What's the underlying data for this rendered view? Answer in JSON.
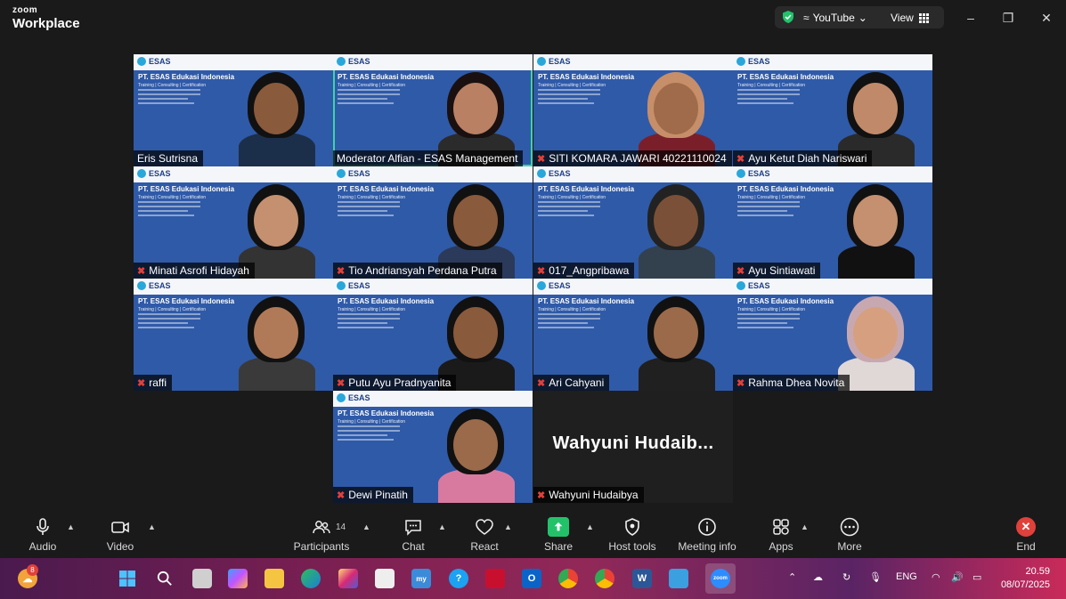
{
  "app": {
    "brand_top": "zoom",
    "brand_bottom": "Workplace"
  },
  "titlebar": {
    "stream_label": "YouTube",
    "view_label": "View"
  },
  "banner": {
    "logo_text": "ESAS",
    "company": "PT. ESAS Edukasi Indonesia",
    "tagline": "Training | Consulting | Certification"
  },
  "participants": [
    {
      "name": "Eris Sutrisna",
      "muted": false
    },
    {
      "name": "Moderator Alfian - ESAS Management",
      "muted": false,
      "active": true
    },
    {
      "name": "SITI KOMARA JAWARI 40221110024",
      "muted": true
    },
    {
      "name": "Ayu Ketut Diah Nariswari",
      "muted": true
    },
    {
      "name": "Minati Asrofi Hidayah",
      "muted": true
    },
    {
      "name": "Tio Andriansyah Perdana Putra",
      "muted": true
    },
    {
      "name": "017_Angpribawa",
      "muted": true
    },
    {
      "name": "Ayu Sintiawati",
      "muted": true
    },
    {
      "name": "raffi",
      "muted": true
    },
    {
      "name": "Putu Ayu Pradnyanita",
      "muted": true
    },
    {
      "name": "Ari Cahyani",
      "muted": true
    },
    {
      "name": "Rahma Dhea Novita",
      "muted": true
    },
    {
      "name": "Dewi Pinatih",
      "muted": true
    },
    {
      "name": "Wahyuni Hudaibya",
      "muted": true,
      "display_text": "Wahyuni  Hudaib..."
    }
  ],
  "toolbar": {
    "audio": "Audio",
    "video": "Video",
    "participants": "Participants",
    "participant_count": "14",
    "chat": "Chat",
    "react": "React",
    "share": "Share",
    "host_tools": "Host tools",
    "meeting_info": "Meeting info",
    "apps": "Apps",
    "more": "More",
    "end": "End"
  },
  "taskbar": {
    "weather_badge": "8",
    "lang": "ENG",
    "time": "20.59",
    "date": "08/07/2025"
  },
  "colors": {
    "accent_green": "#23c26a",
    "end_red": "#e0413a",
    "active_outline": "#3fd3a6",
    "banner_blue": "#2f5aa8"
  }
}
